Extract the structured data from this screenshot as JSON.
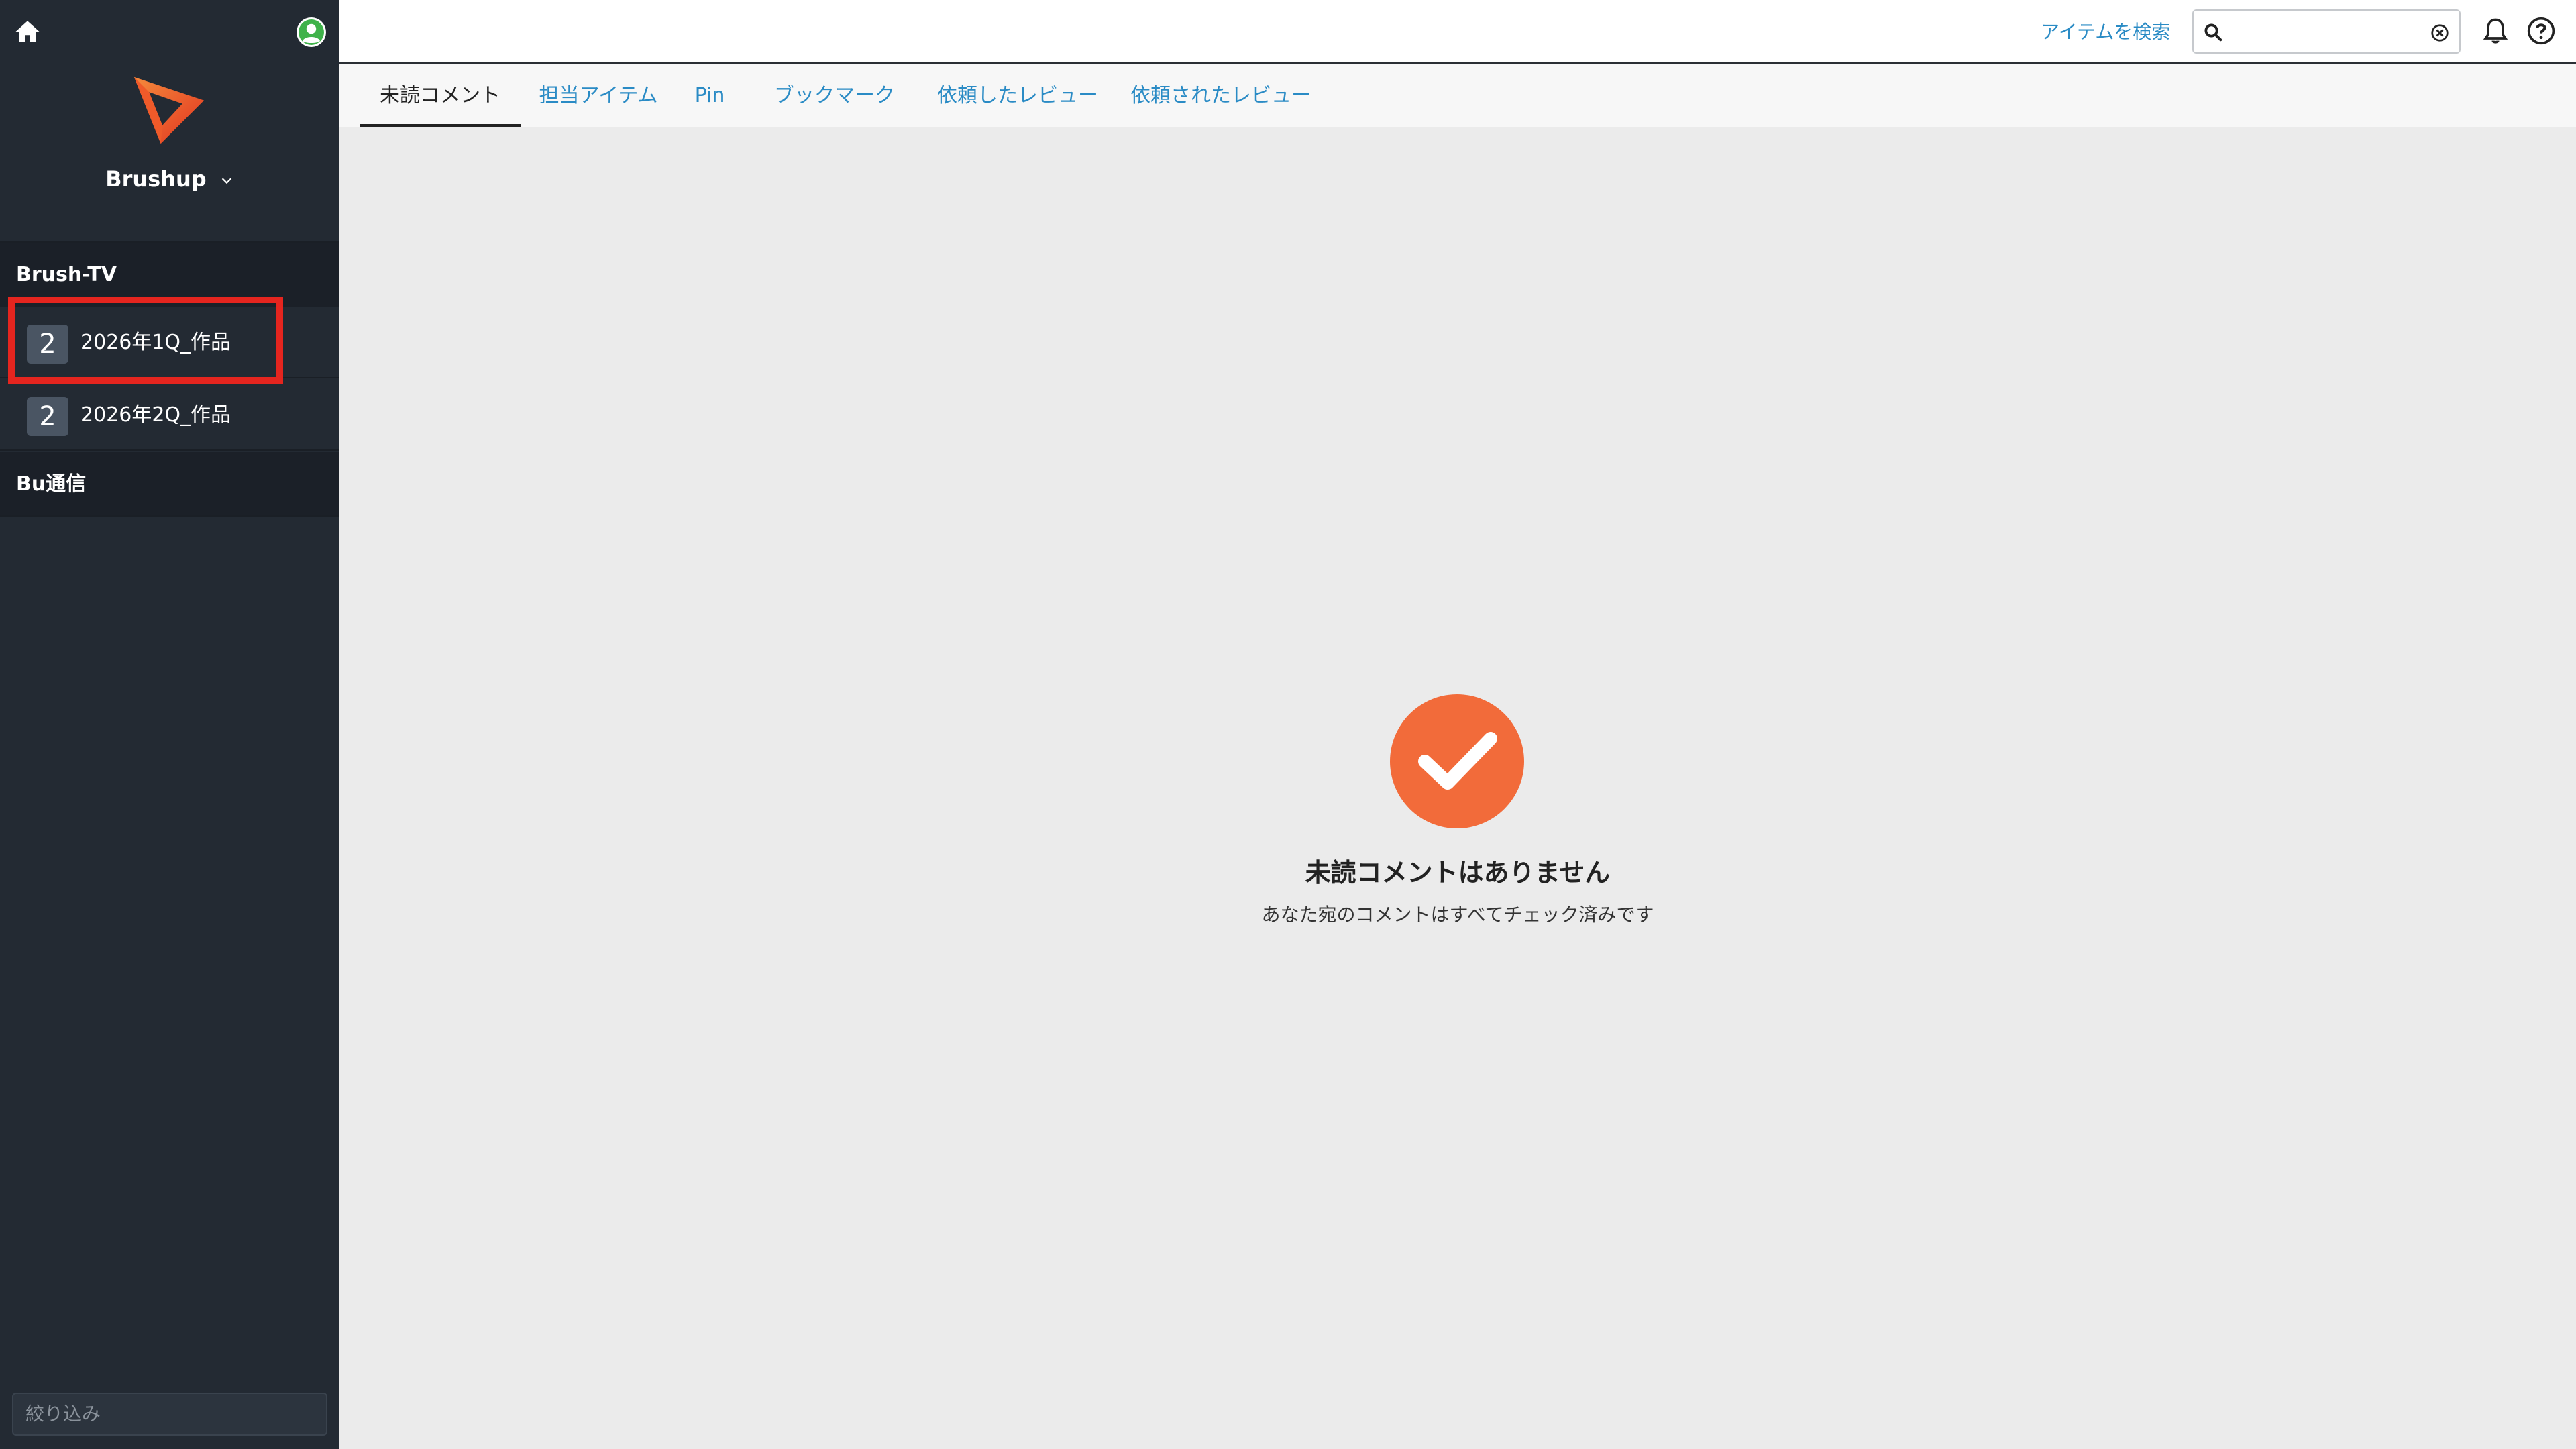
{
  "sidebar": {
    "workspace_name": "Brushup",
    "groups": [
      {
        "name": "Brush-TV",
        "projects": [
          {
            "badge": "2",
            "label": "2026年1Q_作品"
          },
          {
            "badge": "2",
            "label": "2026年2Q_作品"
          }
        ]
      },
      {
        "name": "Bu通信",
        "projects": []
      }
    ],
    "filter_placeholder": "絞り込み"
  },
  "topbar": {
    "search_link": "アイテムを検索",
    "search_value": ""
  },
  "tabs": [
    {
      "label": "未読コメント",
      "active": true
    },
    {
      "label": "担当アイテム",
      "active": false
    },
    {
      "label": "Pin",
      "active": false
    },
    {
      "label": "ブックマーク",
      "active": false
    },
    {
      "label": "依頼したレビュー",
      "active": false
    },
    {
      "label": "依頼されたレビュー",
      "active": false
    }
  ],
  "empty_state": {
    "title": "未読コメントはありません",
    "subtitle": "あなた宛のコメントはすべてチェック済みです"
  },
  "colors": {
    "sidebar_bg": "#232a33",
    "accent_orange": "#f26b3a",
    "link_blue": "#2a8bc5",
    "highlight_red": "#e5251f"
  },
  "icons": {
    "home": "home-icon",
    "user": "user-icon",
    "logo": "brushup-logo-icon",
    "search": "search-icon",
    "clear": "clear-icon",
    "bell": "bell-icon",
    "help": "help-icon",
    "check": "check-icon"
  }
}
